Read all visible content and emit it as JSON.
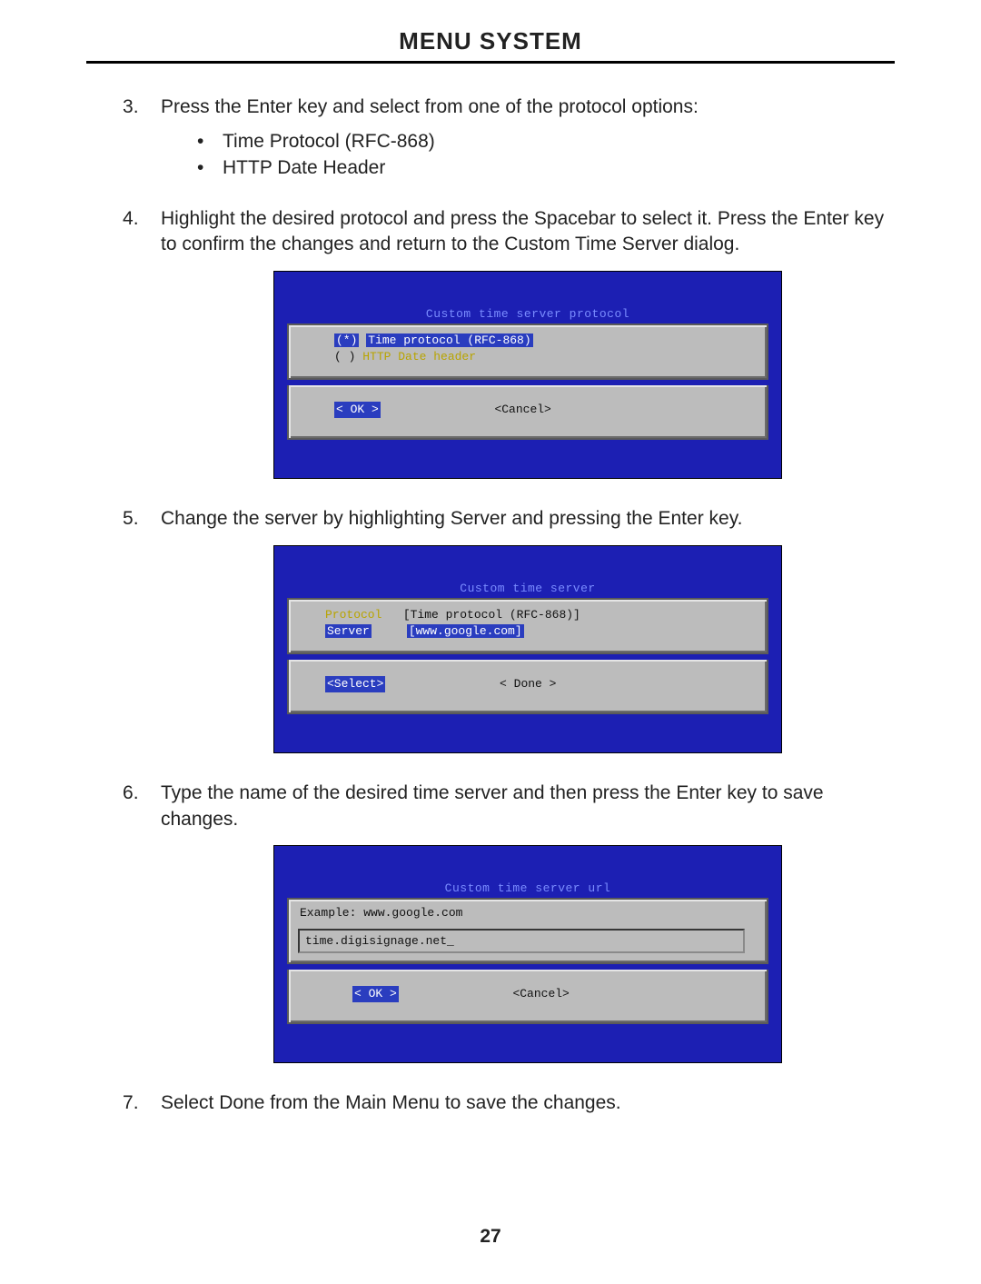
{
  "header": {
    "title": "MENU SYSTEM"
  },
  "steps": {
    "s3": {
      "text": "Press the Enter key and select from one of the protocol options:",
      "bullets": [
        "Time Protocol (RFC-868)",
        "HTTP Date Header"
      ]
    },
    "s4": {
      "text": "Highlight the desired protocol and press the Spacebar to select it.  Press the Enter key to confirm the changes and return to the Custom Time Server dialog."
    },
    "s5": {
      "text": "Change the server by highlighting Server and pressing the Enter key."
    },
    "s6": {
      "text": "Type the name of the desired time server and then press the Enter key to save changes."
    },
    "s7": {
      "text": "Select Done from the Main Menu to save the changes."
    }
  },
  "shot1": {
    "title": "Custom time server protocol",
    "opt_sel_mark": "(*)",
    "opt_unsel_mark": "( )",
    "opt1": "Time protocol (RFC-868)",
    "opt2": "HTTP Date header",
    "ok": "<  OK  >",
    "cancel": "<Cancel>"
  },
  "shot2": {
    "title": "Custom time server",
    "label_protocol": "Protocol",
    "label_server": "Server",
    "val_protocol": "[Time protocol (RFC-868)]",
    "val_server": "[www.google.com]",
    "select": "<Select>",
    "done": "< Done >"
  },
  "shot3": {
    "title": "Custom time server url",
    "example": "Example: www.google.com",
    "input": "time.digisignage.net_",
    "ok": "<  OK  >",
    "cancel": "<Cancel>"
  },
  "page_number": "27"
}
